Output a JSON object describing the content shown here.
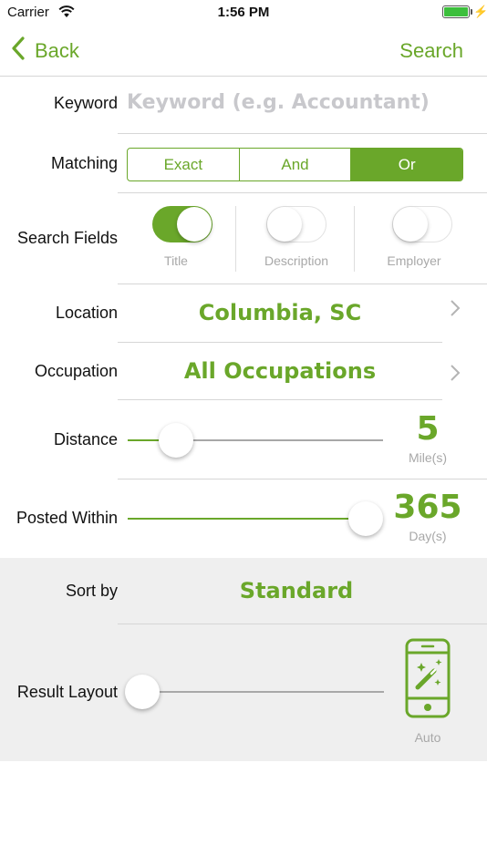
{
  "status_bar": {
    "carrier": "Carrier",
    "time": "1:56 PM"
  },
  "nav": {
    "back_label": "Back",
    "search_label": "Search"
  },
  "keyword": {
    "label": "Keyword",
    "placeholder": "Keyword (e.g. Accountant)"
  },
  "matching": {
    "label": "Matching",
    "options": [
      "Exact",
      "And",
      "Or"
    ],
    "selected": "Or"
  },
  "search_fields": {
    "label": "Search Fields",
    "toggles": [
      {
        "caption": "Title",
        "on": true
      },
      {
        "caption": "Description",
        "on": false
      },
      {
        "caption": "Employer",
        "on": false
      }
    ]
  },
  "location": {
    "label": "Location",
    "value": "Columbia, SC"
  },
  "occupation": {
    "label": "Occupation",
    "value": "All Occupations"
  },
  "distance": {
    "label": "Distance",
    "value": "5",
    "unit": "Mile(s)",
    "slider_fraction": 0.14
  },
  "posted_within": {
    "label": "Posted Within",
    "value": "365",
    "unit": "Day(s)",
    "slider_fraction": 1.0
  },
  "sort_by": {
    "label": "Sort by",
    "value": "Standard"
  },
  "result_layout": {
    "label": "Result Layout",
    "mode_label": "Auto",
    "slider_fraction": 0.0
  },
  "colors": {
    "accent": "#6aa72a",
    "section_bg": "#efefef"
  }
}
